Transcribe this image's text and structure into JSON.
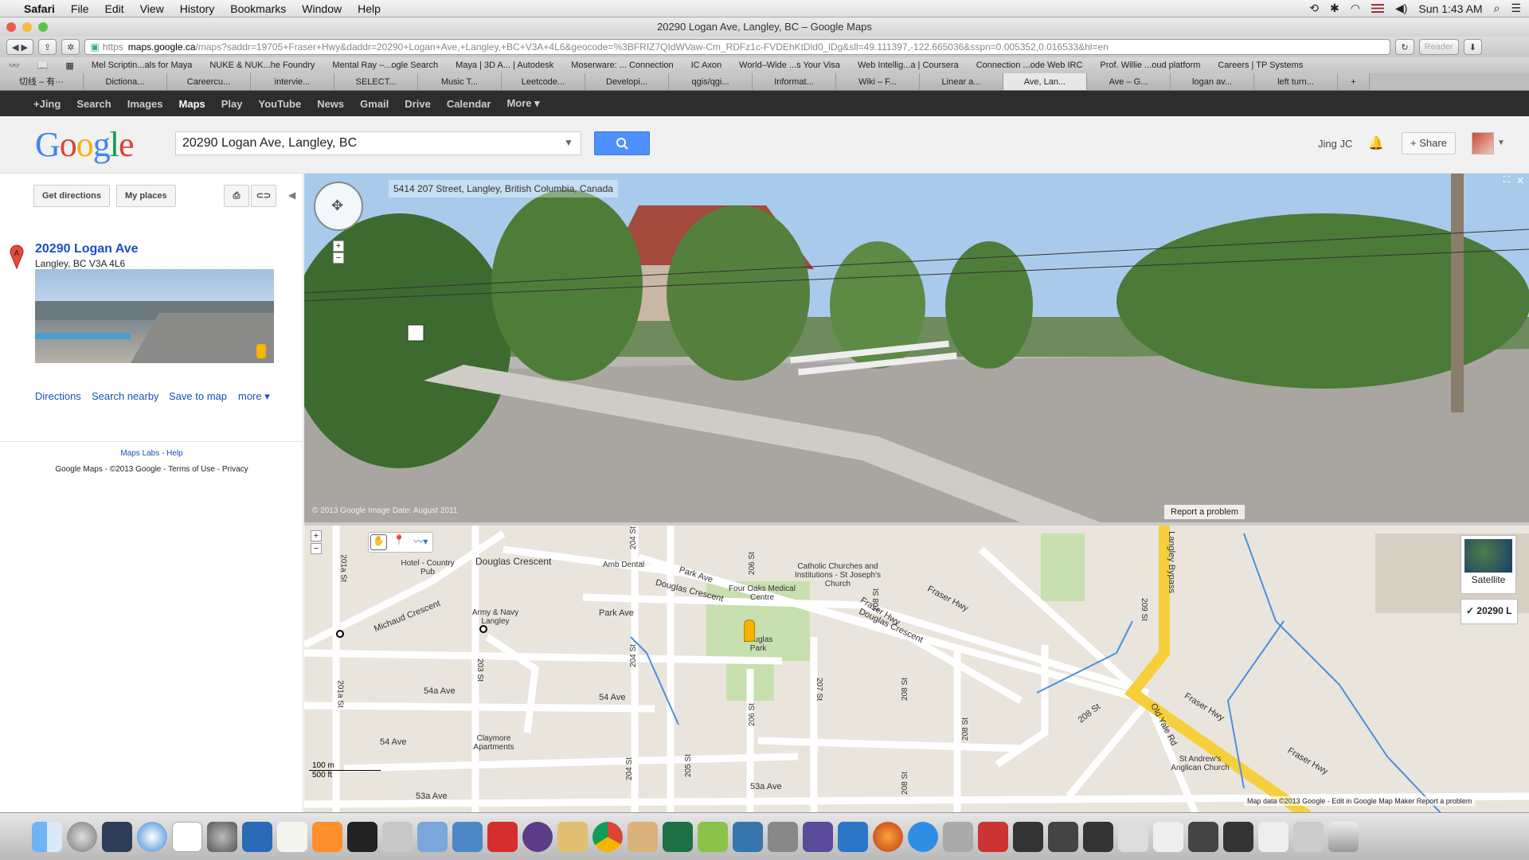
{
  "menubar": {
    "apple": "",
    "app": "Safari",
    "items": [
      "File",
      "Edit",
      "View",
      "History",
      "Bookmarks",
      "Window",
      "Help"
    ],
    "clock": "Sun 1:43 AM"
  },
  "window": {
    "title": "20290 Logan Ave, Langley, BC – Google Maps"
  },
  "toolbar": {
    "url_host": "maps.google.ca",
    "url_rest": "/maps?saddr=19705+Fraser+Hwy&daddr=20290+Logan+Ave,+Langley,+BC+V3A+4L6&geocode=%3BFRIZ7QIdWVaw-Cm_RDFz1c-FVDEhKtDld0_lDg&sll=49.111397,-122.665036&sspn=0.005352,0.016533&hl=en",
    "https": "https",
    "reader": "Reader"
  },
  "bookmarks": [
    "Mel Scriptin...als for Maya",
    "NUKE & NUK...he Foundry",
    "Mental Ray –...ogle Search",
    "Maya | 3D A... | Autodesk",
    "Moserware: ... Connection",
    "IC Axon",
    "World–Wide ...s Your Visa",
    "Web Intellig...a | Coursera",
    "Connection ...ode Web IRC",
    "Prof. Willie ...oud platform",
    "Careers | TP Systems"
  ],
  "tabs": [
    "切线 – 有···",
    "Dictiona...",
    "Careercu...",
    "intervie...",
    "SELECT...",
    "Music T...",
    "Leetcode...",
    "Developi...",
    "qgis/qgi...",
    "Informat...",
    "Wiki – F...",
    "Linear a...",
    "Ave, Lan...",
    "Ave – G...",
    "logan av...",
    "left turn..."
  ],
  "gbar": [
    "+Jing",
    "Search",
    "Images",
    "Maps",
    "Play",
    "YouTube",
    "News",
    "Gmail",
    "Drive",
    "Calendar",
    "More ▾"
  ],
  "header": {
    "logo": "Google",
    "query": "20290 Logan Ave, Langley, BC",
    "username": "Jing JC",
    "share": "+ Share"
  },
  "left": {
    "get_directions": "Get directions",
    "my_places": "My places",
    "marker": "A",
    "place_title": "20290 Logan Ave",
    "place_addr": "Langley, BC V3A 4L6",
    "links": [
      "Directions",
      "Search nearby",
      "Save to map",
      "more ▾"
    ],
    "footer_line1": "Maps Labs - Help",
    "footer_line2": "Google Maps  - ©2013 Google - Terms of Use - Privacy"
  },
  "streetview": {
    "address": "5414 207 Street, Langley, British Columbia, Canada",
    "copyright": "© 2013 Google    Image Date: August 2011",
    "report": "Report a problem"
  },
  "map": {
    "labels": [
      "Douglas Crescent",
      "Hotel - Country Pub",
      "Amb Dental",
      "Park Ave",
      "Four Oaks Medical Centre",
      "Catholic Churches and Institutions - St Joseph's Church",
      "Army & Navy Langley",
      "Michaud Crescent",
      "Park Ave",
      "Douglas Crescent",
      "Fraser Hwy",
      "Douglas Park",
      "54a Ave",
      "54 Ave",
      "54 Ave",
      "Claymore Apartments",
      "53a Ave",
      "53a Ave",
      "Langley Bypass",
      "Fraser Hwy",
      "Fraser Hwy",
      "208 St",
      "Old Yale Rd",
      "St Andrew's Anglican Church",
      "201a St",
      "201a St",
      "203 St",
      "204 St",
      "204 St",
      "205 St",
      "206 St",
      "206 St",
      "207 St",
      "208 St",
      "208 St",
      "208 St",
      "208 St",
      "209 St",
      "Douglas Crescent",
      "Fraser Hwy"
    ],
    "satellite": "Satellite",
    "layer": "✓ 20290 L",
    "scale_m": "100 m",
    "scale_ft": "500 ft",
    "footer": "Map data ©2013 Google  -  Edit in Google Map Maker   Report a problem"
  },
  "colors": {
    "google_blue": "#4285f4",
    "link": "#1a4fc4",
    "road_yellow": "#f6cf3c",
    "park_green": "#c8dfb0",
    "water": "#4a90e2"
  }
}
